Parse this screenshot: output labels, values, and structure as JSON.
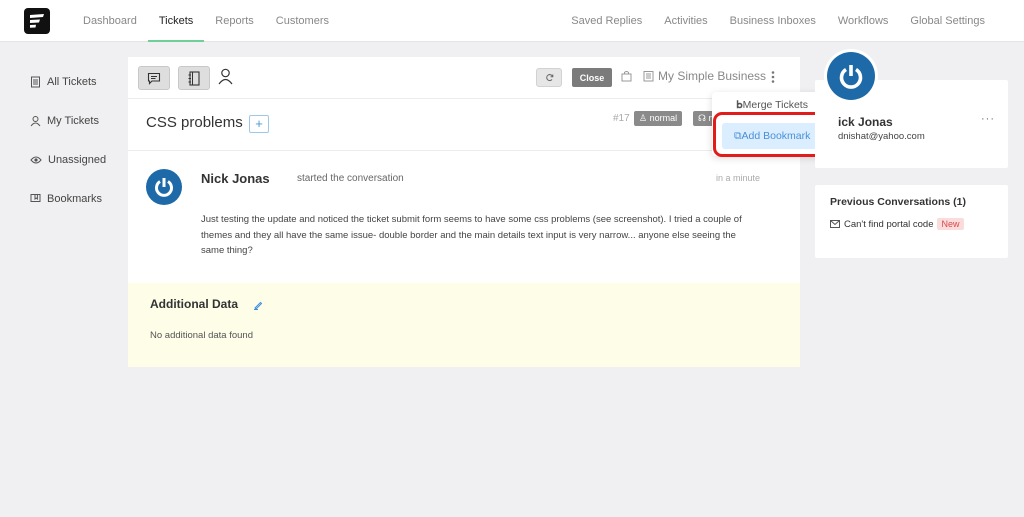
{
  "nav": {
    "left": [
      {
        "label": "Dashboard",
        "active": false
      },
      {
        "label": "Tickets",
        "active": true
      },
      {
        "label": "Reports",
        "active": false
      },
      {
        "label": "Customers",
        "active": false
      }
    ],
    "right": [
      {
        "label": "Saved Replies"
      },
      {
        "label": "Activities"
      },
      {
        "label": "Business Inboxes"
      },
      {
        "label": "Workflows"
      },
      {
        "label": "Global Settings"
      }
    ],
    "accent": "#6fcf97"
  },
  "sidebar": {
    "items": [
      {
        "label": "All Tickets",
        "icon": "document-icon"
      },
      {
        "label": "My Tickets",
        "icon": "person-icon"
      },
      {
        "label": "Unassigned",
        "icon": "eye-icon"
      },
      {
        "label": "Bookmarks",
        "icon": "bookmark-icon"
      }
    ]
  },
  "toolbar": {
    "close_label": "Close",
    "business_name": "My Simple Business"
  },
  "ticket": {
    "title": "CSS problems",
    "plus_label": "+",
    "number": "#17",
    "priority_badge": "normal",
    "second_badge": "n"
  },
  "conversation": {
    "author": "Nick Jonas",
    "action": "started the conversation",
    "time": "in a minute",
    "body": "Just testing the update and noticed the ticket submit form seems to have some css problems (see screenshot). I tried a couple of themes and they all have the same issue- double border and the main details text input is very narrow... anyone else seeing the same thing?"
  },
  "additional_data": {
    "title": "Additional Data",
    "empty_text": "No additional data found"
  },
  "dropdown": {
    "merge_label": "Merge Tickets",
    "bookmark_label": "Add Bookmark",
    "highlight_color": "#e21b1b"
  },
  "profile": {
    "name": "ick Jonas",
    "email": "dnishat@yahoo.com",
    "more_label": "···"
  },
  "previous": {
    "title": "Previous Conversations (1)",
    "items": [
      {
        "label": "Can't find portal code",
        "badge": "New"
      }
    ]
  }
}
